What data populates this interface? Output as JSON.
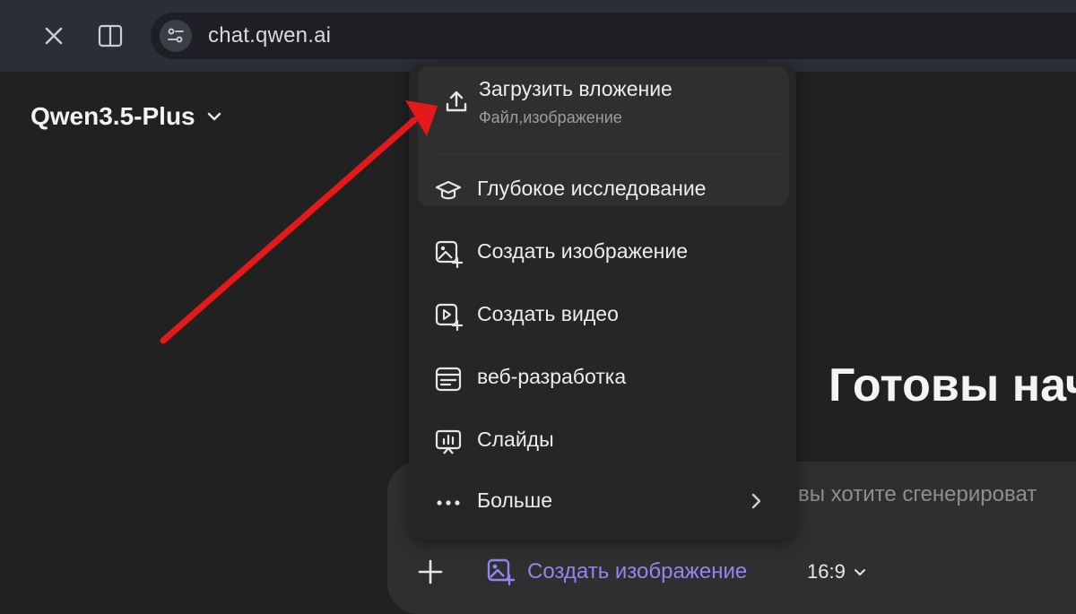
{
  "browser": {
    "url": "chat.qwen.ai"
  },
  "model_selector": {
    "name": "Qwen3.5-Plus"
  },
  "hero_heading": "Готовы нач",
  "composer": {
    "placeholder": "вы хотите сгенерироват",
    "mode_chip_label": "Создать изображение",
    "aspect_ratio": "16:9"
  },
  "menu": {
    "upload": {
      "title": "Загрузить вложение",
      "subtitle": "Файл,изображение"
    },
    "items": [
      {
        "label": "Глубокое исследование",
        "icon": "graduation-cap-icon"
      },
      {
        "label": "Создать изображение",
        "icon": "image-plus-icon"
      },
      {
        "label": "Создать видео",
        "icon": "video-plus-icon"
      },
      {
        "label": "веб-разработка",
        "icon": "browser-window-icon"
      },
      {
        "label": "Слайды",
        "icon": "presentation-icon"
      },
      {
        "label": "Больше",
        "icon": "more-dots-icon"
      }
    ]
  },
  "colors": {
    "accent": "#8f87f1",
    "annotation_arrow": "#e5191c"
  }
}
